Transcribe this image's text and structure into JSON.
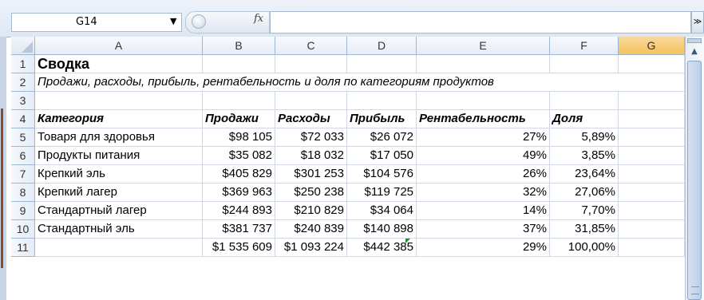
{
  "formula_bar": {
    "name_box": "G14",
    "fx_label": "fx",
    "formula": "",
    "expand_glyph": "≫"
  },
  "columns": [
    "A",
    "B",
    "C",
    "D",
    "E",
    "F",
    "G"
  ],
  "selected_column": "G",
  "rows": [
    {
      "num": "1",
      "A": "Сводка",
      "B": "",
      "C": "",
      "D": "",
      "E": "",
      "F": ""
    },
    {
      "num": "2",
      "A": "Продажи, расходы, прибыль, рентабельность и доля по категориям продуктов",
      "B": "",
      "C": "",
      "D": "",
      "E": "",
      "F": ""
    },
    {
      "num": "3",
      "A": "",
      "B": "",
      "C": "",
      "D": "",
      "E": "",
      "F": ""
    },
    {
      "num": "4",
      "A": "Категория",
      "B": "Продажи",
      "C": "Расходы",
      "D": "Прибыль",
      "E": "Рентабельность",
      "F": "Доля"
    },
    {
      "num": "5",
      "A": "Товаря для здоровья",
      "B": "$98 105",
      "C": "$72 033",
      "D": "$26 072",
      "E": "27%",
      "F": "5,89%"
    },
    {
      "num": "6",
      "A": "Продукты питания",
      "B": "$35 082",
      "C": "$18 032",
      "D": "$17 050",
      "E": "49%",
      "F": "3,85%"
    },
    {
      "num": "7",
      "A": "Крепкий эль",
      "B": "$405 829",
      "C": "$301 253",
      "D": "$104 576",
      "E": "26%",
      "F": "23,64%"
    },
    {
      "num": "8",
      "A": "Крепкий лагер",
      "B": "$369 963",
      "C": "$250 238",
      "D": "$119 725",
      "E": "32%",
      "F": "27,06%"
    },
    {
      "num": "9",
      "A": "Стандартный лагер",
      "B": "$244 893",
      "C": "$210 829",
      "D": "$34 064",
      "E": "14%",
      "F": "7,70%"
    },
    {
      "num": "10",
      "A": "Стандартный эль",
      "B": "$381 737",
      "C": "$240 839",
      "D": "$140 898",
      "E": "37%",
      "F": "31,85%"
    },
    {
      "num": "11",
      "A": "",
      "B": "$1 535 609",
      "C": "$1 093 224",
      "D": "$442 385",
      "E": "29%",
      "F": "100,00%"
    }
  ]
}
